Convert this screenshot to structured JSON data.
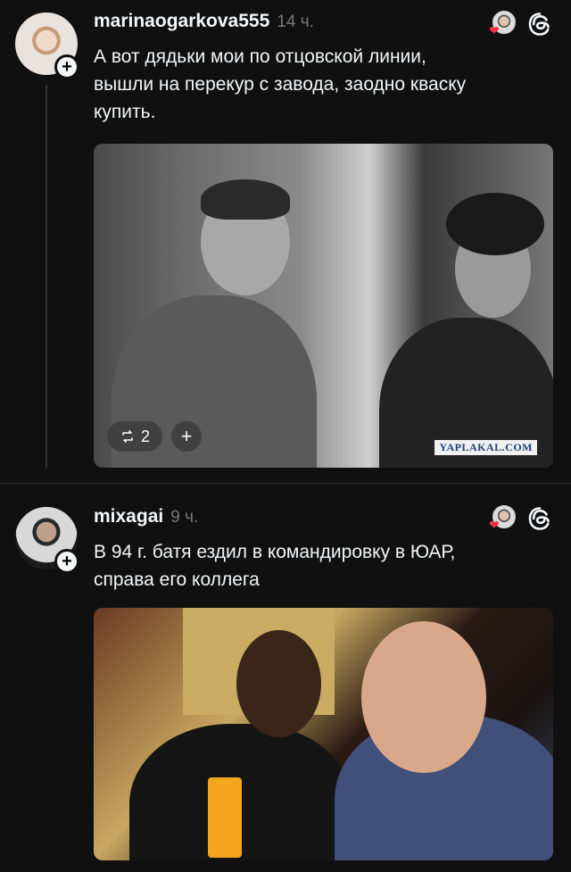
{
  "posts": [
    {
      "username": "marinaogarkova555",
      "time": "14 ч.",
      "text": "А вот дядьки мои по отцовской линии,\nвышли на перекур с завода, заодно кваску\nкупить.",
      "photo": {
        "repost_count": "2",
        "watermark": "YAPLAKAL.COM"
      }
    },
    {
      "username": "mixagai",
      "time": "9 ч.",
      "text": "В 94 г. батя ездил в командировку в ЮАР,\nсправа его коллега"
    }
  ],
  "colors": {
    "background": "#101010",
    "text_primary": "#f3f5f7",
    "text_secondary": "#777777",
    "heart": "#ff3040"
  },
  "icons": {
    "threads": "threads-logo-icon",
    "repost": "repost-icon",
    "add": "plus-icon"
  }
}
